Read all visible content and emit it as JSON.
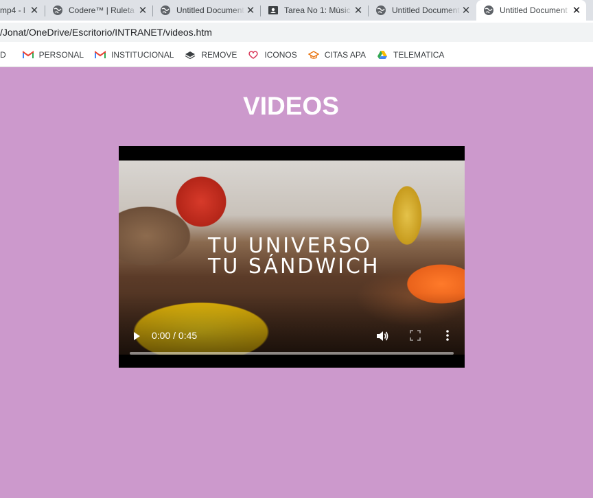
{
  "browser": {
    "tabs": [
      {
        "title": "mp4 - l",
        "favicon": "file-icon",
        "active": false
      },
      {
        "title": "Codere™ | Ruleta",
        "favicon": "globe-icon",
        "active": false
      },
      {
        "title": "Untitled Document",
        "favicon": "globe-icon",
        "active": false
      },
      {
        "title": "Tarea No 1: Músic",
        "favicon": "classroom-icon",
        "active": false
      },
      {
        "title": "Untitled Document",
        "favicon": "globe-icon",
        "active": false
      },
      {
        "title": "Untitled Document",
        "favicon": "globe-icon",
        "active": true
      }
    ],
    "address": "/Jonat/OneDrive/Escritorio/INTRANET/videos.htm",
    "bookmarks": [
      {
        "label": "D",
        "icon": ""
      },
      {
        "label": "PERSONAL",
        "icon": "gmail-icon"
      },
      {
        "label": "INSTITUCIONAL",
        "icon": "gmail-icon"
      },
      {
        "label": "REMOVE",
        "icon": "layers-icon"
      },
      {
        "label": "ICONOS",
        "icon": "heart-icon"
      },
      {
        "label": "CITAS APA",
        "icon": "graduation-cap-icon"
      },
      {
        "label": "TELEMATICA",
        "icon": "google-drive-icon"
      }
    ]
  },
  "page": {
    "heading": "VIDEOS",
    "background_color": "#cc99cc"
  },
  "video": {
    "tagline_line1": "TU UNIVERSO",
    "tagline_line2": "TU SÁNDWICH",
    "time": "0:00 / 0:45",
    "progress": 0.0
  }
}
